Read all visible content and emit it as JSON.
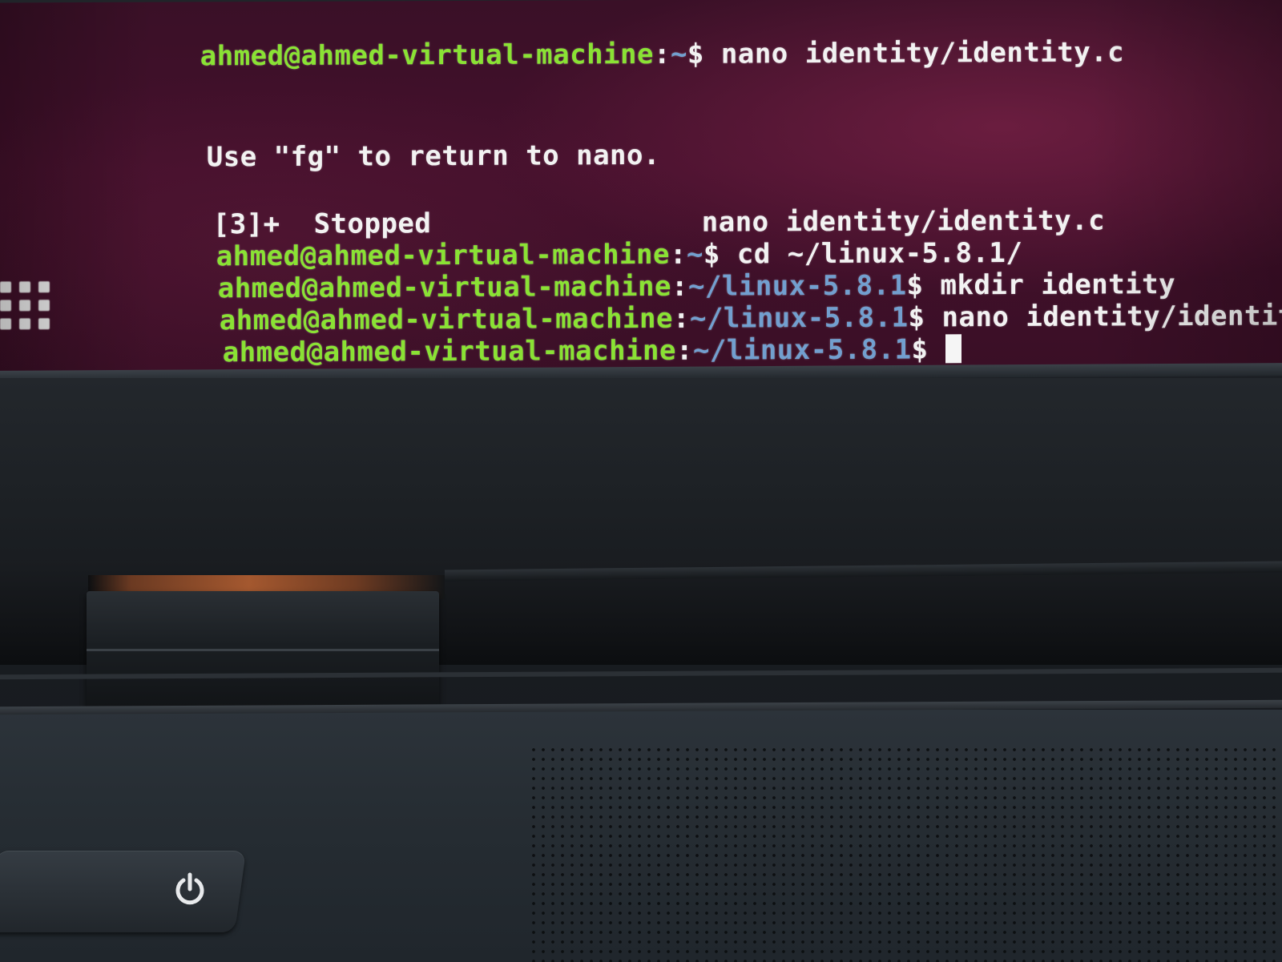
{
  "terminal": {
    "prompt_user": "ahmed@ahmed-virtual-machine",
    "lines": [
      {
        "user": "ahmed@ahmed-virtual-machine",
        "sep": ":",
        "path": "~",
        "dollar": "$ ",
        "cmd": "nano identity/identity.c"
      },
      {
        "text": "Use \"fg\" to return to nano."
      },
      {
        "job": "[3]+  Stopped",
        "job_cmd": "nano identity/identity.c"
      },
      {
        "user": "ahmed@ahmed-virtual-machine",
        "sep": ":",
        "path": "~",
        "dollar": "$ ",
        "cmd": "cd ~/linux-5.8.1/"
      },
      {
        "user": "ahmed@ahmed-virtual-machine",
        "sep": ":",
        "path": "~/linux-5.8.1",
        "dollar": "$ ",
        "cmd": "mkdir identity"
      },
      {
        "user": "ahmed@ahmed-virtual-machine",
        "sep": ":",
        "path": "~/linux-5.8.1",
        "dollar": "$ ",
        "cmd": "nano identity/identity.c"
      },
      {
        "user": "ahmed@ahmed-virtual-machine",
        "sep": ":",
        "path": "~/linux-5.8.1",
        "dollar": "$ ",
        "cmd": ""
      }
    ]
  },
  "colors": {
    "prompt_user": "#8ae234",
    "prompt_path": "#729fcf",
    "text": "#f2f2f2",
    "background": "#3a1027"
  },
  "icons": {
    "app_grid": "show-applications-icon",
    "power": "power-icon"
  }
}
